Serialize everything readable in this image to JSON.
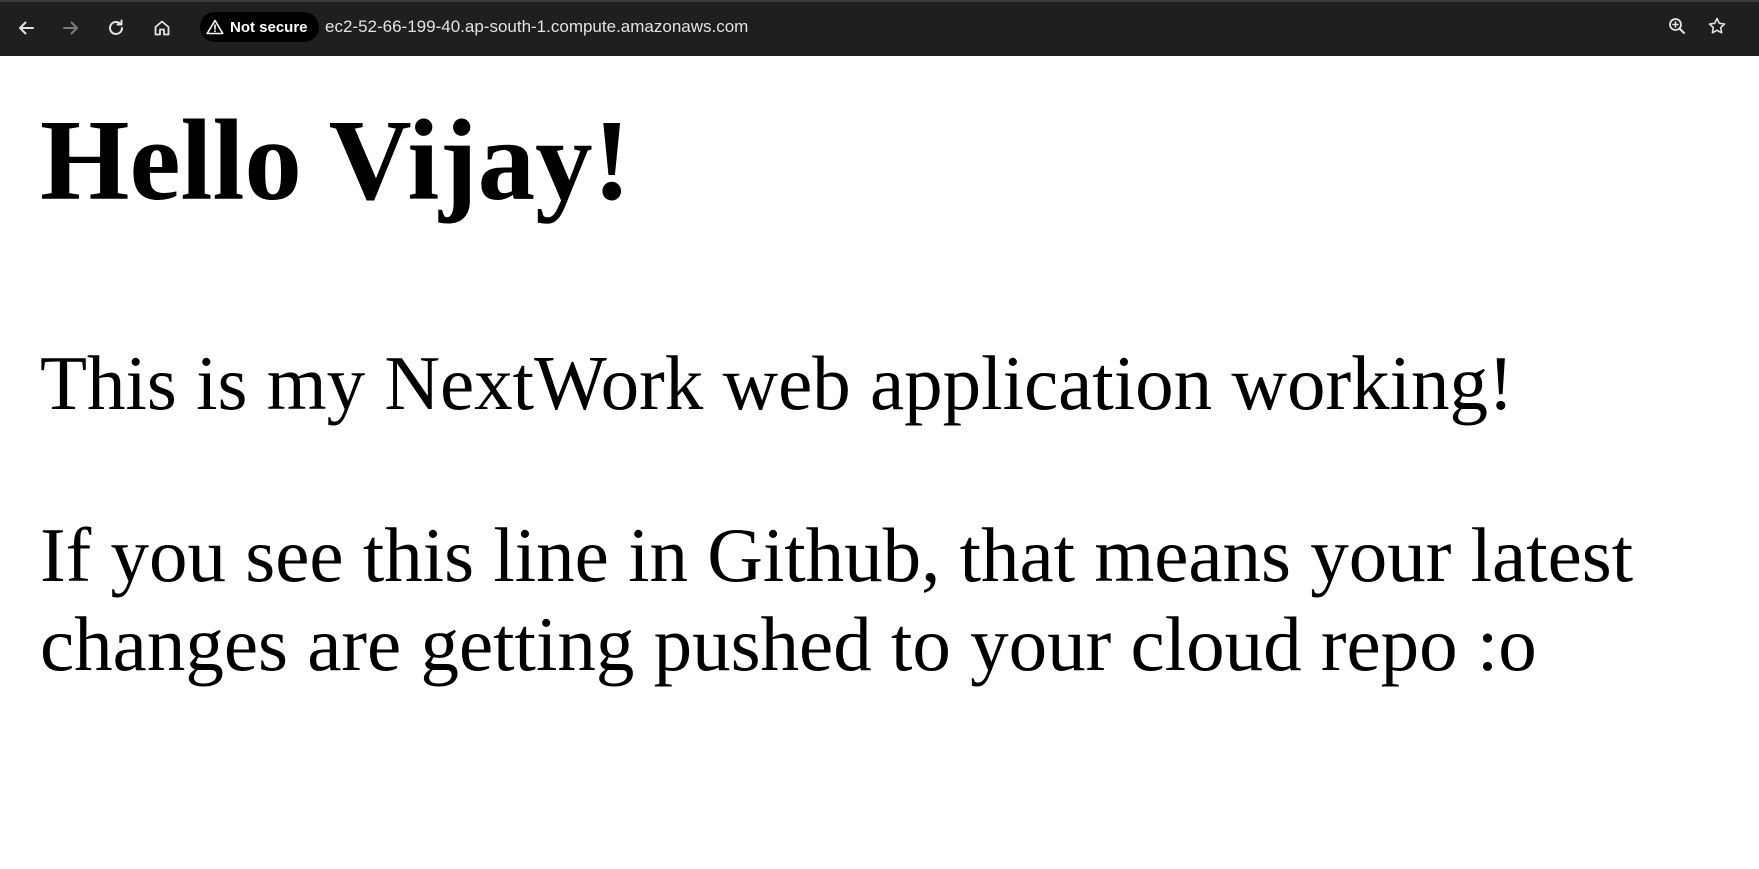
{
  "browser": {
    "security_label": "Not secure",
    "url": "ec2-52-66-199-40.ap-south-1.compute.amazonaws.com",
    "icons": [
      "back-arrow-icon",
      "forward-arrow-icon",
      "reload-icon",
      "home-icon",
      "warning-triangle-icon",
      "zoom-icon",
      "bookmark-star-icon"
    ],
    "colors": {
      "toolbar_bg": "#1f1f1f",
      "chip_bg": "#000000",
      "url_text": "#e3e3e3",
      "icon_active": "#e3e3e3",
      "icon_disabled": "#7a7a7a"
    }
  },
  "page": {
    "heading": "Hello Vijay!",
    "paragraph1": "This is my NextWork web application working!",
    "paragraph2_line1": "If you see this line in Github, that means your latest",
    "paragraph2_line2": "changes are getting pushed to your cloud repo :o"
  }
}
